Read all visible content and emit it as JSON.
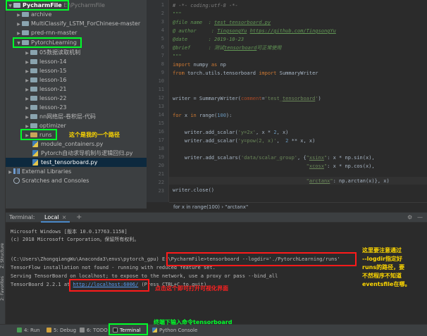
{
  "left_tabs": {
    "structure": "Z: Structure",
    "favorites": "2: Favorites"
  },
  "project": {
    "root_name": "PycharmFile",
    "root_path": "E:\\PycharmFile",
    "folders": [
      "archive",
      "MultiClassify_LSTM_ForChinese-master",
      "pred-rnn-master"
    ],
    "open_folder": "PytorchLearning",
    "sub_folders": [
      "05数据读取机制",
      "lesson-14",
      "lesson-15",
      "lesson-16",
      "lesson-21",
      "lesson-22",
      "lesson-23",
      "nn网络层-卷积层-代码",
      "optimizer",
      "runs"
    ],
    "files": [
      "module_containers.py",
      "Pytorch自动求导机制与逻辑回归.py",
      "test_tensorboard.py"
    ],
    "external": "External Libraries",
    "scratches": "Scratches and Consoles"
  },
  "editor": {
    "line_numbers": [
      "1",
      "2",
      "3",
      "4",
      "5",
      "6",
      "7",
      "8",
      "9",
      "10",
      "11",
      "12",
      "13",
      "14",
      "15",
      "16",
      "17",
      "18",
      "19",
      "20",
      "21",
      "22",
      "23"
    ],
    "code": {
      "l1": "# -*- coding:utf-8 -*-",
      "l2": "\"\"\"",
      "l3a": "@file name  : ",
      "l3b": "test_tensorboard.py",
      "l4a": "@ author     : ",
      "l4b": "TingsongYu",
      "l4c": " ",
      "l4d": "https://github.com/TingsongYu",
      "l5": "@date       : 2019-10-23",
      "l6a": "@brief      : 测试",
      "l6b": "tensorboard",
      "l6c": "可正常使用",
      "l7": "\"\"\"",
      "l8a": "import",
      "l8b": " numpy ",
      "l8c": "as",
      "l8d": " np",
      "l9a": "from",
      "l9b": " torch.utils.tensorboard ",
      "l9c": "import",
      "l9d": " SummaryWriter",
      "l12a": "writer = SummaryWriter(",
      "l12b": "comment",
      "l12c": "=",
      "l12d": "'test_",
      "l12e": "tensorboard",
      "l12f": "'",
      "l12g": ")",
      "l14a": "for",
      "l14b": " x ",
      "l14c": "in",
      "l14d": " range(",
      "l14e": "100",
      "l14f": "):",
      "l16a": "    writer.add_scalar(",
      "l16b": "'y=2x'",
      "l16c": ", x * ",
      "l16d": "2",
      "l16e": ", x)",
      "l17a": "    writer.add_scalar(",
      "l17b": "'y=pow(2, x)'",
      "l17c": ",  ",
      "l17d": "2",
      "l17e": " ** x, x)",
      "l19a": "    writer.add_scalars(",
      "l19b": "'data/scalar_group'",
      "l19c": ", {",
      "l19d": "\"",
      "l19e": "xsinx",
      "l19f": "\"",
      "l19g": ": x * np.sin(x),",
      "l20a": "                                             ",
      "l20b": "\"",
      "l20c": "xcosx",
      "l20d": "\"",
      "l20e": ": x * np.cos(x),",
      "l21a": "                                             ",
      "l21b": "\"",
      "l21c": "arctanx",
      "l21d": "\"",
      "l21e": ": np.arctan(x)}, x)",
      "l22": "writer.close()"
    },
    "breadcrumb": "for x in range(100)   ›   \"arctanx\""
  },
  "terminal": {
    "label": "Terminal:",
    "tab": "Local",
    "tab_close": "×",
    "add": "+",
    "settings": "⚙",
    "hide": "—",
    "lines": {
      "t1": "Microsoft Windows [版本 10.0.17763.1158]",
      "t2": "(c) 2018 Microsoft Corporation。保留所有权利。",
      "t3a": "(C:\\Users\\ZhongqiangWu\\Anaconda3\\envs\\pytorch_gpu) ",
      "t3b": "E:\\PycharmFile>tensorboard --logdir='./PytorchLearning/runs'",
      "t4": "TensorFlow installation not found - running with reduced feature set.",
      "t5": "Serving TensorBoard on localhost; to expose to the network, use a proxy or pass --bind_all",
      "t6a": "TensorBoard 2.2.1 at ",
      "t6b": "http://localhost:6006/",
      "t6c": " (Press CTRL+C to quit)"
    }
  },
  "bottom_tools": {
    "run": "4: Run",
    "debug": "5: Debug",
    "todo": "6: TODO",
    "terminal": "Terminal",
    "python_console": "Python Console"
  },
  "annotations": {
    "runs_note": "这个是我的一个路径",
    "logdir_note": [
      "这里要注意通过",
      "--logdir指定好",
      "runs的路径，要",
      "不然程序不知道",
      "eventsfile在哪。"
    ],
    "link_note": "点击这个即可打开可视化界面",
    "terminal_note": "终端下输入命令tensorboard"
  },
  "colors": {
    "highlight_green": "#00ff2a",
    "highlight_red": "#ff1a1a",
    "note_yellow": "#ffd800",
    "selection": "#0d293e"
  }
}
